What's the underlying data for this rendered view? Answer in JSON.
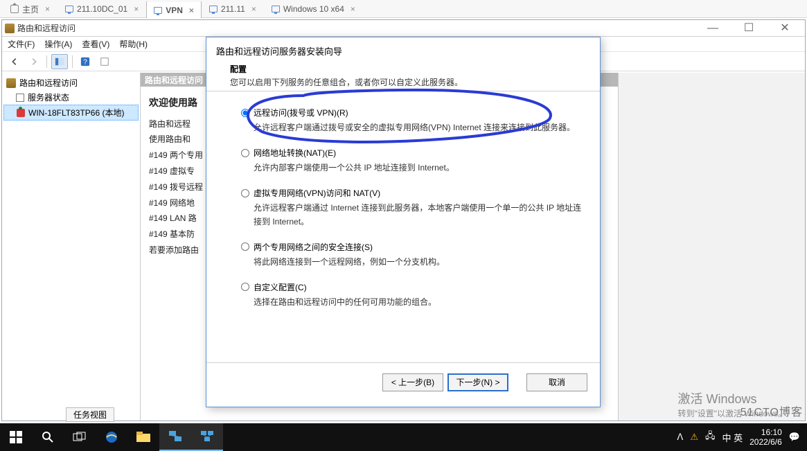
{
  "vm_tabs": [
    {
      "label": "主页",
      "icon": "home"
    },
    {
      "label": "211.10DC_01",
      "icon": "vm"
    },
    {
      "label": "VPN",
      "icon": "vm",
      "active": true
    },
    {
      "label": "211.11",
      "icon": "vm"
    },
    {
      "label": "Windows 10 x64",
      "icon": "vm"
    }
  ],
  "app": {
    "title": "路由和远程访问",
    "menus": [
      "文件(F)",
      "操作(A)",
      "查看(V)",
      "帮助(H)"
    ]
  },
  "tree": {
    "root": "路由和远程访问",
    "items": [
      {
        "label": "服务器状态",
        "icon": "state"
      },
      {
        "label": "WIN-18FLT83TP66 (本地)",
        "icon": "srv",
        "selected": true
      }
    ]
  },
  "main": {
    "col_title": "路由和远程访问",
    "welcome": "欢迎使用路",
    "lines": [
      "路由和远程",
      "使用路由和",
      "#149 两个专用",
      "#149 虚拟专",
      "#149 拨号远程",
      "#149 网络地",
      "#149 LAN 路",
      "#149 基本防",
      "若要添加路由"
    ]
  },
  "wizard": {
    "title": "路由和远程访问服务器安装向导",
    "section": "配置",
    "section_desc": "您可以启用下列服务的任意组合，或者你可以自定义此服务器。",
    "options": [
      {
        "label": "远程访问(拨号或 VPN)(R)",
        "desc": "允许远程客户端通过拨号或安全的虚拟专用网络(VPN) Internet 连接来连接到此服务器。",
        "checked": true
      },
      {
        "label": "网络地址转换(NAT)(E)",
        "desc": "允许内部客户端使用一个公共 IP 地址连接到 Internet。"
      },
      {
        "label": "虚拟专用网络(VPN)访问和 NAT(V)",
        "desc": "允许远程客户端通过 Internet 连接到此服务器，本地客户端使用一个单一的公共 IP 地址连接到 Internet。"
      },
      {
        "label": "两个专用网络之间的安全连接(S)",
        "desc": "将此网络连接到一个远程网络，例如一个分支机构。"
      },
      {
        "label": "自定义配置(C)",
        "desc": "选择在路由和远程访问中的任何可用功能的组合。"
      }
    ],
    "buttons": {
      "back": "< 上一步(B)",
      "next": "下一步(N) >",
      "cancel": "取消"
    }
  },
  "task_tab": "任务视图",
  "watermark": {
    "l1": "激活 Windows",
    "l2": "转到\"设置\"以激活 Windows。",
    "wm2": "51CTO博客"
  },
  "tray": {
    "time": "16:10",
    "date": "2022/6/6",
    "ime": "中 英",
    "net": "✓",
    "up": "ᐱ",
    "bubble": "💬"
  }
}
